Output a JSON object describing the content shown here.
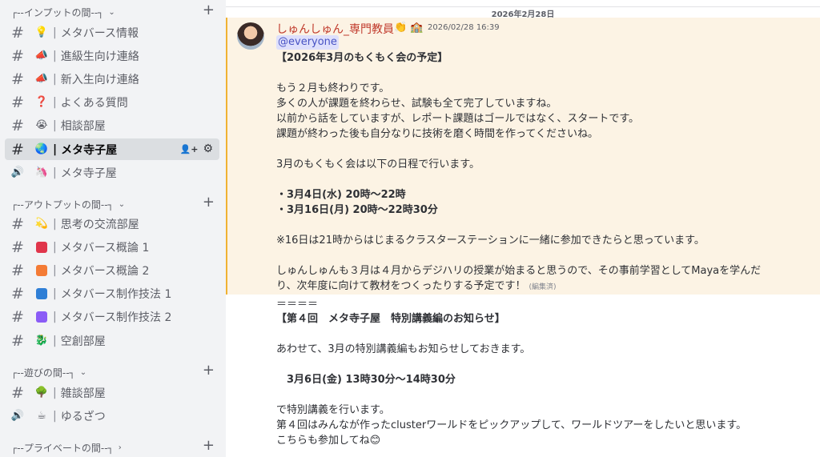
{
  "sidebar": {
    "categories": [
      {
        "label": "┌--インプットの間--┐",
        "chevron": "⌄"
      },
      {
        "label": "┌--アウトプットの間--┐",
        "chevron": "⌄"
      },
      {
        "label": "┌--遊びの間--┐",
        "chevron": "⌄"
      },
      {
        "label": "┌--プライベートの間--┐",
        "chevron": "›"
      }
    ],
    "add_symbol": "+",
    "channels": [
      {
        "type": "#",
        "emoji": "💡",
        "sep": "|",
        "name": "メタバース情報"
      },
      {
        "type": "#",
        "emoji": "📣",
        "sep": "|",
        "name": "進級生向け連絡"
      },
      {
        "type": "#",
        "emoji": "📣",
        "sep": "|",
        "name": "新入生向け連絡"
      },
      {
        "type": "#",
        "emoji": "❓",
        "sep": "|",
        "name": "よくある質問"
      },
      {
        "type": "#",
        "emoji": "😭",
        "sep": "|",
        "name": "相談部屋"
      },
      {
        "type": "#",
        "emoji": "🌏",
        "sep": "|",
        "name": "メタ寺子屋"
      },
      {
        "type": "🔊",
        "emoji": "🦄",
        "sep": "|",
        "name": "メタ寺子屋"
      },
      {
        "type": "#",
        "emoji": "💫",
        "sep": "|",
        "name": "思考の交流部屋"
      },
      {
        "type": "#",
        "emoji": "",
        "sep": "|",
        "name": "メタバース概論 1"
      },
      {
        "type": "#",
        "emoji": "",
        "sep": "|",
        "name": "メタバース概論 2"
      },
      {
        "type": "#",
        "emoji": "",
        "sep": "|",
        "name": "メタバース制作技法 1"
      },
      {
        "type": "#",
        "emoji": "",
        "sep": "|",
        "name": "メタバース制作技法 2"
      },
      {
        "type": "#",
        "emoji": "🐉",
        "sep": "|",
        "name": "空創部屋"
      },
      {
        "type": "#",
        "emoji": "🌳",
        "sep": "|",
        "name": "雑談部屋"
      },
      {
        "type": "🔊",
        "emoji": "☕",
        "sep": "|",
        "name": "ゆるざつ"
      }
    ],
    "square_colors": [
      "#e0354b",
      "#f47b35",
      "#2f7fd6",
      "#8b5cf6"
    ],
    "active_actions": {
      "invite_icon": "👤+",
      "settings_icon": "⚙"
    }
  },
  "main": {
    "date_divider": "2026年2月28日",
    "message": {
      "username": "しゅんしゅん_専門教員",
      "badges": "👏 🏫",
      "timestamp": "2026/02/28 16:39",
      "mention": "@everyone",
      "lines": [
        "【2026年3月のもくもく会の予定】",
        "",
        "もう２月も終わりです。",
        "多くの人が課題を終わらせ、試験も全て完了していますね。",
        "以前から話をしていますが、レポート課題はゴールではなく、スタートです。",
        "課題が終わった後も自分なりに技術を磨く時間を作ってくださいね。",
        "",
        "3月のもくもく会は以下の日程で行います。",
        "",
        "・3月4日(水) 20時～22時",
        "・3月16日(月) 20時～22時30分",
        "",
        "※16日は21時からはじまるクラスターステーションに一緒に参加できたらと思っています。",
        "",
        "しゅんしゅんも３月は４月からデジハリの授業が始まると思うので、その事前学習としてMayaを学んだ",
        "り、次年度に向けて教材をつくったりする予定です！"
      ],
      "edited": "(編集済)",
      "follow_lines": [
        "＝＝＝＝",
        "【第４回　メタ寺子屋　特別講義編のお知らせ】",
        "",
        "あわせて、3月の特別講義編もお知らせしておきます。",
        "",
        "　3月6日(金) 13時30分～14時30分",
        "",
        "で特別講義を行います。",
        "第４回はみんなが作ったclusterワールドをピックアップして、ワールドツアーをしたいと思います。",
        "こちらも参加してね😊"
      ]
    }
  }
}
